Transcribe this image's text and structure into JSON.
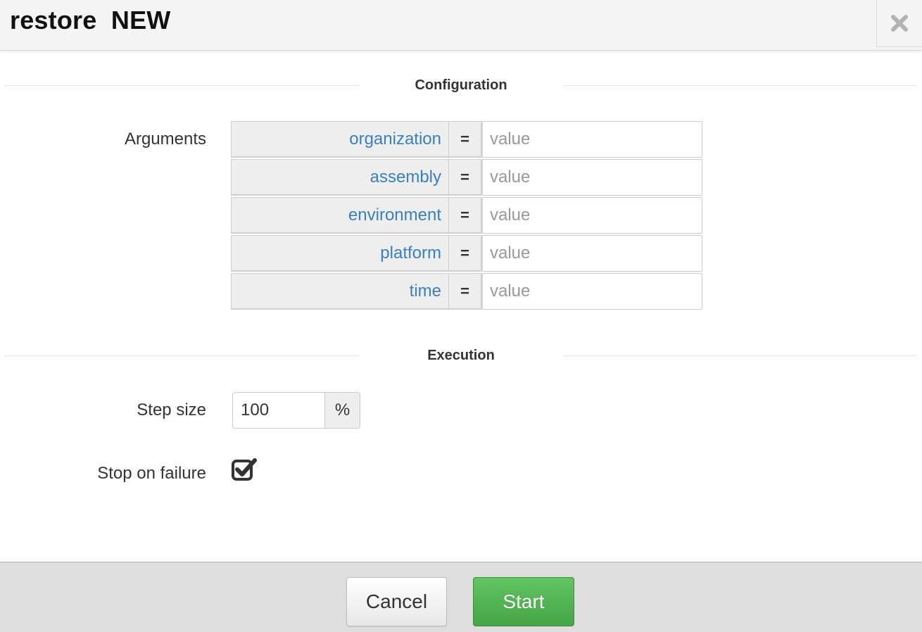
{
  "dialog": {
    "title": "restore  NEW",
    "close_icon": "close-icon"
  },
  "configuration": {
    "section_title": "Configuration",
    "arguments_label": "Arguments",
    "arguments": [
      {
        "name": "organization",
        "separator": "=",
        "placeholder": "value",
        "value": ""
      },
      {
        "name": "assembly",
        "separator": "=",
        "placeholder": "value",
        "value": ""
      },
      {
        "name": "environment",
        "separator": "=",
        "placeholder": "value",
        "value": ""
      },
      {
        "name": "platform",
        "separator": "=",
        "placeholder": "value",
        "value": ""
      },
      {
        "name": "time",
        "separator": "=",
        "placeholder": "value",
        "value": ""
      }
    ]
  },
  "execution": {
    "section_title": "Execution",
    "step_size_label": "Step size",
    "step_size_value": "100",
    "step_size_unit": "%",
    "stop_on_failure_label": "Stop on failure",
    "stop_on_failure_checked": true,
    "checkbox_icon": "checked-checkbox-icon"
  },
  "footer": {
    "cancel_label": "Cancel",
    "start_label": "Start"
  },
  "colors": {
    "argument_name": "#3a7fc1",
    "start_button": "#52b352",
    "header_background": "#f4f4f4",
    "footer_background": "#dedede"
  }
}
